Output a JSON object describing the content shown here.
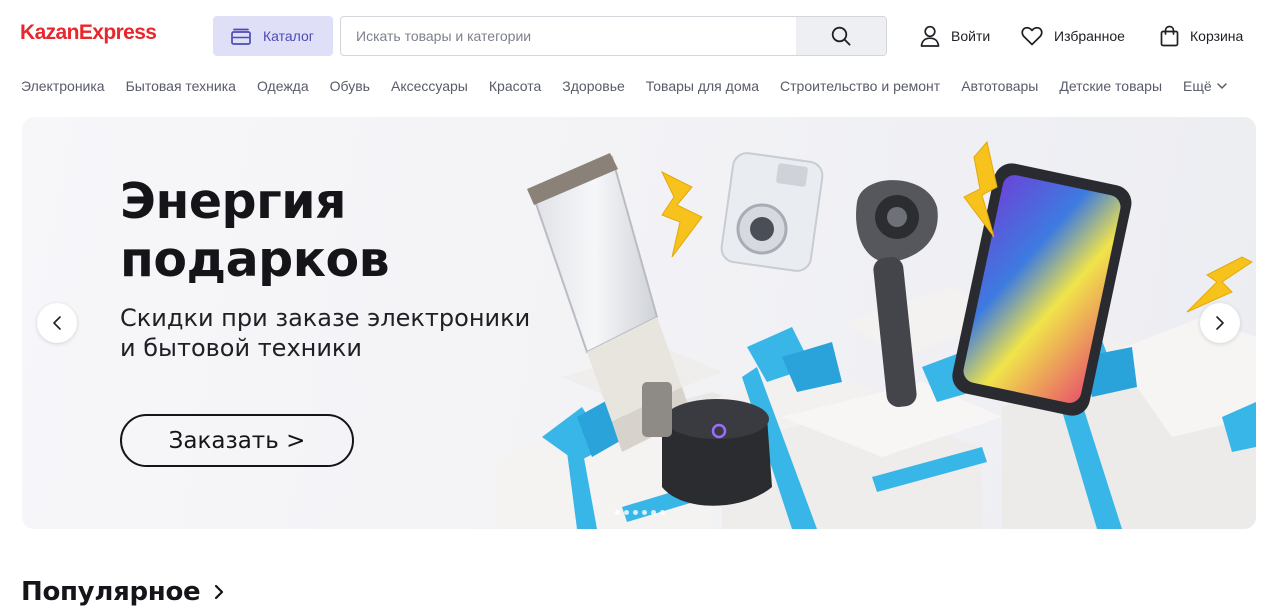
{
  "header": {
    "logo": "KazanExpress",
    "catalog_label": "Каталог",
    "search_placeholder": "Искать товары и категории",
    "login_label": "Войти",
    "favorites_label": "Избранное",
    "cart_label": "Корзина"
  },
  "categories": [
    "Электроника",
    "Бытовая техника",
    "Одежда",
    "Обувь",
    "Аксессуары",
    "Красота",
    "Здоровье",
    "Товары для дома",
    "Строительство и ремонт",
    "Автотовары",
    "Детские товары"
  ],
  "more_label": "Ещё",
  "banner": {
    "title_line1": "Энергия",
    "title_line2": "подарков",
    "subtitle_line1": "Скидки при заказе электроники",
    "subtitle_line2": "и бытовой техники",
    "cta_label": "Заказать >",
    "slide_count": 6,
    "active_slide": 1
  },
  "popular_title": "Популярное",
  "colors": {
    "brand": "#e8262b",
    "catalog_bg": "#dfe0f7",
    "catalog_text": "#4d4bb5",
    "ribbon": "#38b6e8",
    "bolt": "#f7c21b"
  },
  "icons": {
    "catalog": "catalog-icon",
    "search": "search-icon",
    "login": "user-icon",
    "favorites": "heart-icon",
    "cart": "bag-icon",
    "more": "chevron-down-icon",
    "prev": "chevron-left-icon",
    "next": "chevron-right-icon",
    "popular": "chevron-right-icon"
  }
}
